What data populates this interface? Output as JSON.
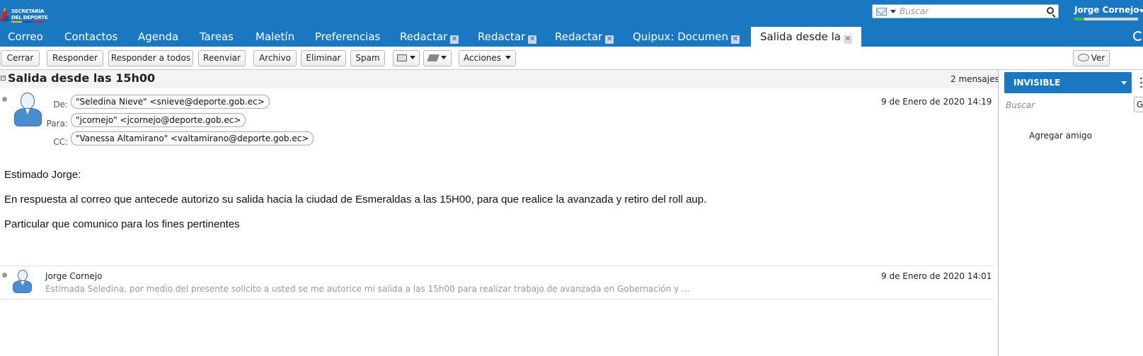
{
  "header": {
    "logo_line1": "SECRETARÍA",
    "logo_line2": "DEL DEPORTE",
    "search_placeholder": "Buscar",
    "username": "Jorge Cornejo"
  },
  "tabs": [
    {
      "label": "Correo",
      "closable": false,
      "active": false
    },
    {
      "label": "Contactos",
      "closable": false,
      "active": false
    },
    {
      "label": "Agenda",
      "closable": false,
      "active": false
    },
    {
      "label": "Tareas",
      "closable": false,
      "active": false
    },
    {
      "label": "Maletín",
      "closable": false,
      "active": false
    },
    {
      "label": "Preferencias",
      "closable": false,
      "active": false
    },
    {
      "label": "Redactar",
      "closable": true,
      "active": false
    },
    {
      "label": "Redactar",
      "closable": true,
      "active": false
    },
    {
      "label": "Redactar",
      "closable": true,
      "active": false
    },
    {
      "label": "Quipux: Documen",
      "closable": true,
      "active": false
    },
    {
      "label": "Salida desde la",
      "closable": true,
      "active": true
    }
  ],
  "toolbar": {
    "close": "Cerrar",
    "reply": "Responder",
    "reply_all": "Responder a todos",
    "forward": "Reenviar",
    "archive": "Archivo",
    "delete": "Eliminar",
    "spam": "Spam",
    "actions": "Acciones",
    "view": "Ver"
  },
  "conversation": {
    "subject": "Salida desde las 15h00",
    "count": "2 mensajes",
    "message1": {
      "from_label": "De:",
      "to_label": "Para:",
      "cc_label": "CC:",
      "from": "\"Seledina Nieve\" <snieve@deporte.gob.ec>",
      "to": "\"jcornejo\" <jcornejo@deporte.gob.ec>",
      "cc": "\"Vanessa Altamirano\" <valtamirano@deporte.gob.ec>",
      "date": "9 de Enero de 2020 14:19",
      "body": [
        "Estimado Jorge:",
        "En respuesta al correo que antecede  autorizo su salida hacia la ciudad de Esmeraldas a las 15H00, para que realice la avanzada y retiro del roll aup.",
        "Particular que comunico para los fines pertinentes"
      ]
    },
    "message2": {
      "sender": "Jorge Cornejo",
      "date": "9 de Enero de 2020 14:01",
      "snippet": "Estimada Seledina, por medio del presente solicito a usted se me autorice mi salida a las 15h00 para realizar trabajo de avanzada en Gobernación y ..."
    }
  },
  "chat": {
    "status": "INVISIBLE",
    "search_placeholder": "Buscar",
    "search_button": "G",
    "add_friend": "Agregar amigo"
  }
}
